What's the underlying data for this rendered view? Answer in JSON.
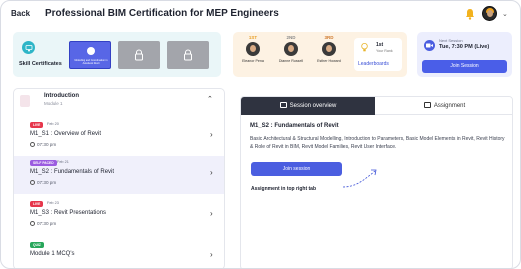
{
  "header": {
    "back_label": "Back",
    "title": "Professional BIM Certification for MEP Engineers"
  },
  "skills": {
    "label": "Skill Certificates",
    "certificate_text": "Modelling and Coordination in Autodesk Revit"
  },
  "leaderboard": {
    "people": [
      {
        "rank": "1ST",
        "name": "Eleanor Pena"
      },
      {
        "rank": "2ND",
        "name": "Dianne Russell"
      },
      {
        "rank": "3RD",
        "name": "Esther Howard"
      }
    ],
    "your_rank": "1st",
    "your_rank_label": "Your Rank",
    "link_label": "Leaderboards"
  },
  "next_session": {
    "label": "Next Session",
    "time": "Tue, 7:30 PM (Live)",
    "button_label": "Join Session"
  },
  "module": {
    "title": "Introduction",
    "subtitle": "Module 1",
    "lessons": [
      {
        "tag": "LIVE",
        "date": "Feb 20",
        "title": "M1_S1 : Overview of Revit",
        "time": "07:30 pm"
      },
      {
        "tag": "SELF PACED",
        "date": "Feb 21",
        "title": "M1_S2 : Fundamentals of Revit",
        "time": "07:30 pm"
      },
      {
        "tag": "LIVE",
        "date": "Feb 23",
        "title": "M1_S3 : Revit Presentations",
        "time": "07:30 pm"
      },
      {
        "tag": "QUIZ",
        "date": "",
        "title": "Module 1 MCQ's",
        "time": ""
      }
    ]
  },
  "content": {
    "tabs": [
      "Session overview",
      "Assignment"
    ],
    "title": "M1_S2 : Fundamentals of Revit",
    "description": "Basic Architectural & Structural Modelling, Introduction to Parameters, Basic Model Elements in Revit, Revit History & Role of Revit in BIM, Revit Model Families, Revit User Interface.",
    "join_label": "Join session",
    "note": "Assignment in top right tab"
  },
  "colors": {
    "accent": "#4b5ee0",
    "live": "#e6364b",
    "self_paced": "#9b5ce0",
    "quiz": "#27a65a"
  }
}
